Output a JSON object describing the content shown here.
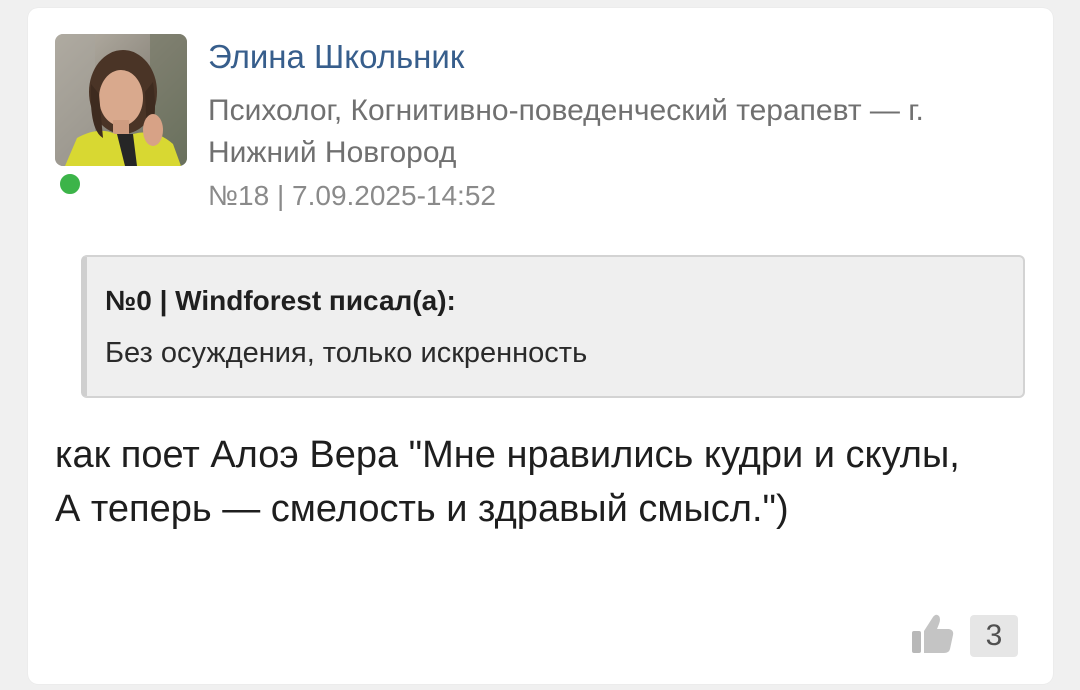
{
  "post": {
    "author": {
      "name": "Элина Школьник",
      "title": "Психолог, Когнитивно-поведенческий терапевт — г. Нижний Новгород",
      "online": true,
      "avatar": "avatar-photo"
    },
    "meta": "№18 | 7.09.2025-14:52",
    "quote": {
      "header": "№0 | Windforest писал(а):",
      "text": "Без осуждения, только искренность"
    },
    "body_lines": [
      "как поет Алоэ Вера \"Мне нравились кудри и скулы,",
      "А теперь — смелость и здравый смысл.\")"
    ],
    "likes": {
      "icon": "thumbs-up-icon",
      "count": "3"
    }
  },
  "colors": {
    "author_name": "#375e8c",
    "online": "#3cb449",
    "quote_bg": "#efefef"
  }
}
